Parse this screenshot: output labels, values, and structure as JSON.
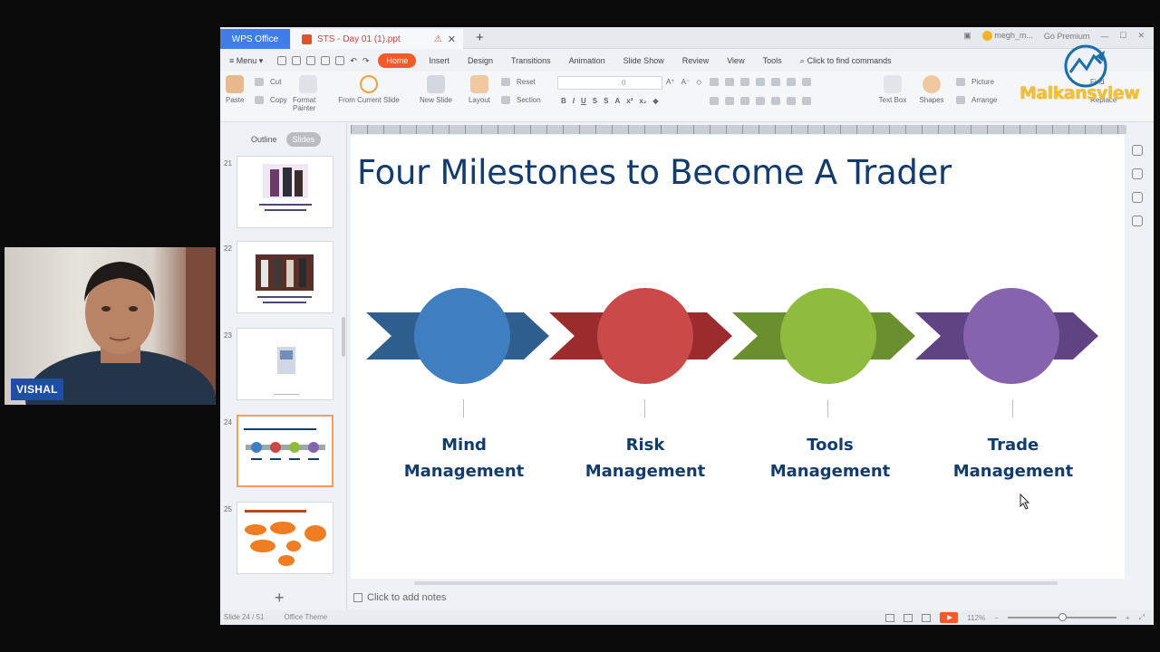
{
  "webcam": {
    "name_tag": "VISHAL"
  },
  "titlebar": {
    "home_tab": "WPS Office",
    "doc_tab": "STS - Day 01 (1).ppt",
    "user": "megh_m...",
    "premium": "Go Premium"
  },
  "menubar": {
    "menu": "Menu",
    "items": [
      "Home",
      "Insert",
      "Design",
      "Transitions",
      "Animation",
      "Slide Show",
      "Review",
      "View",
      "Tools"
    ],
    "find": "Click to find commands"
  },
  "ribbon": {
    "paste": "Paste",
    "cut": "Cut",
    "copy": "Copy",
    "format_painter": "Format Painter",
    "from_current": "From Current Slide",
    "new_slide": "New Slide",
    "layout": "Layout",
    "reset": "Reset",
    "section": "Section",
    "font_size": "0",
    "text_box": "Text Box",
    "shapes": "Shapes",
    "picture": "Picture",
    "arrange": "Arrange",
    "find": "Find",
    "replace": "Replace",
    "logo_text": "Malkansview"
  },
  "left_panel": {
    "tab_outline": "Outline",
    "tab_slides": "Slides",
    "thumbnails": [
      {
        "num": "21",
        "caption": "Long term 16 Stars Retail win ... to 20 Awis Mailadrag ... Sean"
      },
      {
        "num": "22",
        "caption": "To Last Retail System in Connected for ..."
      },
      {
        "num": "23",
        "caption": ""
      },
      {
        "num": "24",
        "caption": "Four Milestones to Become A Trader"
      },
      {
        "num": "25",
        "caption": "CHARACTERISTICS OF TRADERS"
      }
    ]
  },
  "slide": {
    "title": "Four Milestones to Become A Trader",
    "milestones": [
      {
        "line1": "Mind",
        "line2": "Management",
        "color": "#3f7fc1",
        "arrow": "#2e5f8e"
      },
      {
        "line1": "Risk",
        "line2": "Management",
        "color": "#c94a48",
        "arrow": "#9c2b2e"
      },
      {
        "line1": "Tools",
        "line2": "Management",
        "color": "#8fbc3f",
        "arrow": "#6a8f2e"
      },
      {
        "line1": "Trade",
        "line2": "Management",
        "color": "#8664ad",
        "arrow": "#5f4383"
      }
    ]
  },
  "notes": {
    "placeholder": "Click to add notes"
  },
  "statusbar": {
    "slide_info": "Slide 24 / 51",
    "theme": "Office Theme",
    "zoom": "112%"
  }
}
